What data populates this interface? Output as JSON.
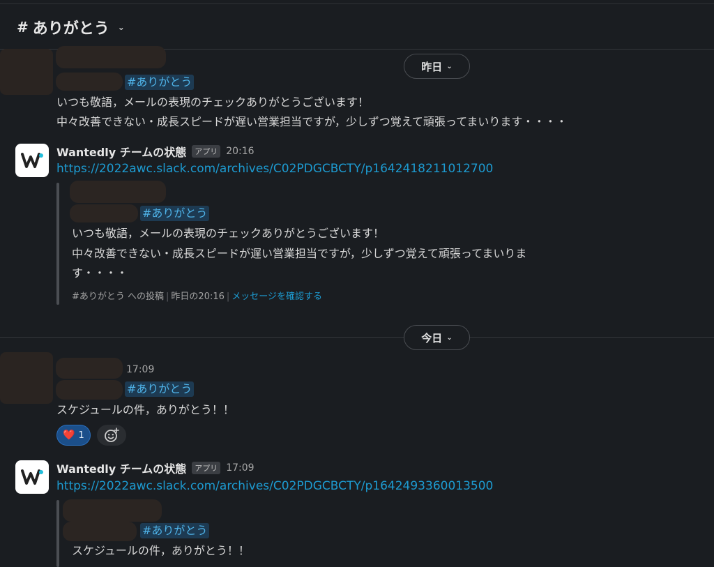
{
  "channel": {
    "hash": "#",
    "name": "ありがとう",
    "chevron": "⌄"
  },
  "dividers": {
    "yesterday": "昨日",
    "today": "今日",
    "chevron": "⌄"
  },
  "tag": "#ありがとう",
  "msg1": {
    "lines": [
      "いつも敬語，メールの表現のチェックありがとうございます！",
      "中々改善できない・成長スピードが遅い営業担当ですが，少しずつ覚えて頑張ってまいります・・・・"
    ]
  },
  "app1": {
    "name": "Wantedly チームの状態",
    "badge": "アプリ",
    "time": "20:16",
    "link": "https://2022awc.slack.com/archives/C02PDGCBCTY/p1642418211012700",
    "quote_lines": [
      "いつも敬語，メールの表現のチェックありがとうございます！",
      "中々改善できない・成長スピードが遅い営業担当ですが，少しずつ覚えて頑張ってまいりま",
      "す・・・・"
    ],
    "meta": {
      "posted_in": "#ありがとう への投稿",
      "when": "昨日の20:16",
      "view": "メッセージを確認する"
    }
  },
  "msg2": {
    "time": "17:09",
    "text": "スケジュールの件，ありがとう！！",
    "reaction": {
      "emoji": "❤️",
      "count": "1"
    }
  },
  "app2": {
    "name": "Wantedly チームの状態",
    "badge": "アプリ",
    "time": "17:09",
    "link": "https://2022awc.slack.com/archives/C02PDGCBCTY/p1642493360013500",
    "quote_text": "スケジュールの件，ありがとう！！"
  },
  "colors": {
    "background": "#1a1d21",
    "link": "#1d9bd1",
    "channel_tag_bg": "#1d3a52",
    "reaction_bg": "#1b4f8a"
  },
  "icons": {
    "app_logo": "wantedly-logo-icon",
    "add_reaction": "add-emoji-icon"
  }
}
